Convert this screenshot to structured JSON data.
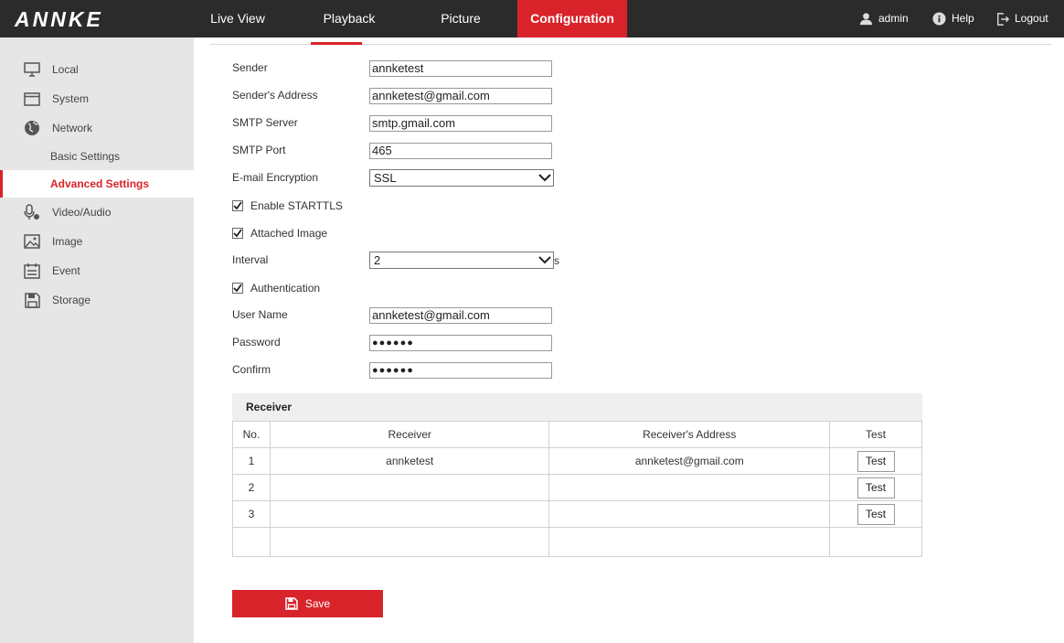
{
  "app": {
    "logo": "ANNKE"
  },
  "nav": {
    "items": [
      {
        "label": "Live View"
      },
      {
        "label": "Playback"
      },
      {
        "label": "Picture"
      },
      {
        "label": "Configuration",
        "active": true
      }
    ],
    "user": "admin",
    "help": "Help",
    "logout": "Logout"
  },
  "sidebar": {
    "items": [
      {
        "label": "Local",
        "icon": "monitor-icon"
      },
      {
        "label": "System",
        "icon": "window-icon"
      },
      {
        "label": "Network",
        "icon": "globe-icon"
      }
    ],
    "network_sub": [
      {
        "label": "Basic Settings"
      },
      {
        "label": "Advanced Settings",
        "active": true
      }
    ],
    "items_after": [
      {
        "label": "Video/Audio",
        "icon": "video-audio-icon"
      },
      {
        "label": "Image",
        "icon": "image-icon"
      },
      {
        "label": "Event",
        "icon": "calendar-icon"
      },
      {
        "label": "Storage",
        "icon": "floppy-icon"
      }
    ]
  },
  "form": {
    "sender": {
      "label": "Sender",
      "value": "annketest"
    },
    "sender_address": {
      "label": "Sender's Address",
      "value": "annketest@gmail.com"
    },
    "smtp_server": {
      "label": "SMTP Server",
      "value": "smtp.gmail.com"
    },
    "smtp_port": {
      "label": "SMTP Port",
      "value": "465"
    },
    "encryption": {
      "label": "E-mail Encryption",
      "value": "SSL"
    },
    "starttls": {
      "label": "Enable STARTTLS",
      "checked": true
    },
    "attached_image": {
      "label": "Attached Image",
      "checked": true
    },
    "interval": {
      "label": "Interval",
      "value": "2",
      "unit": "s"
    },
    "authentication": {
      "label": "Authentication",
      "checked": true
    },
    "user_name": {
      "label": "User Name",
      "value": "annketest@gmail.com"
    },
    "password": {
      "label": "Password",
      "value": "●●●●●●"
    },
    "confirm": {
      "label": "Confirm",
      "value": "●●●●●●"
    }
  },
  "receiver": {
    "title": "Receiver",
    "columns": [
      "No.",
      "Receiver",
      "Receiver's Address",
      "Test"
    ],
    "rows": [
      {
        "no": "1",
        "receiver": "annketest",
        "address": "annketest@gmail.com",
        "test": "Test"
      },
      {
        "no": "2",
        "receiver": "",
        "address": "",
        "test": "Test"
      },
      {
        "no": "3",
        "receiver": "",
        "address": "",
        "test": "Test"
      }
    ]
  },
  "save": {
    "label": "Save"
  },
  "colors": {
    "accent": "#d8232a",
    "topbar": "#2b2b2b",
    "sidebar": "#e6e6e6"
  }
}
